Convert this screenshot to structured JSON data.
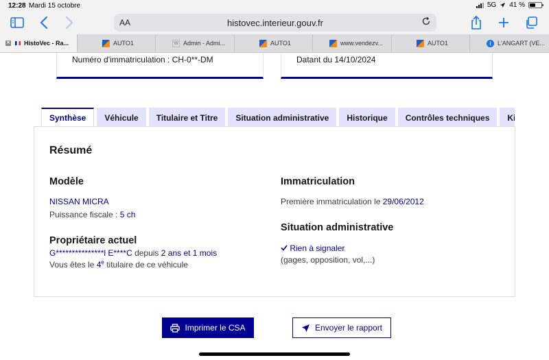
{
  "statusbar": {
    "time": "12:28",
    "date": "Mardi 15 octobre",
    "network": "5G",
    "battery": "41 %"
  },
  "browser": {
    "address_aa": "AA",
    "url": "histovec.interieur.gouv.fr",
    "tabs": [
      {
        "label": "HistoVec - Ra...",
        "active": true,
        "favicon": "french-flag-icon"
      },
      {
        "label": "AUTO1",
        "favicon": "auto1-icon"
      },
      {
        "label": "Admin - Admi...",
        "favicon": "w-icon"
      },
      {
        "label": "AUTO1",
        "favicon": "auto1-icon"
      },
      {
        "label": "www.vendezv...",
        "favicon": "auto1-icon"
      },
      {
        "label": "AUTO1",
        "favicon": "auto1-icon"
      },
      {
        "label": "L'ANGART (VE...",
        "favicon": "info-icon"
      }
    ]
  },
  "topcards": {
    "left": "Numéro d'immatriculation : CH-0**-DM",
    "right": "Datant du 14/10/2024"
  },
  "content_tabs": [
    "Synthèse",
    "Véhicule",
    "Titulaire et Titre",
    "Situation administrative",
    "Historique",
    "Contrôles techniques",
    "Kilo"
  ],
  "summary": {
    "title": "Résumé",
    "modele": {
      "heading": "Modèle",
      "name": "NISSAN MICRA",
      "power_label": "Puissance fiscale : ",
      "power_value": "5 ch"
    },
    "proprietaire": {
      "heading": "Propriétaire actuel",
      "name": "G***************l E****C",
      "since_label": " depuis ",
      "since_value": "2 ans et 1 mois",
      "titulaire_prefix": "Vous êtes le ",
      "titulaire_num": "4",
      "titulaire_sup": "e",
      "titulaire_suffix": " titulaire de ce véhicule"
    },
    "immatriculation": {
      "heading": "Immatriculation",
      "label": "Première immatriculation le ",
      "date": "29/06/2012"
    },
    "situation": {
      "heading": "Situation administrative",
      "status": "Rien à signaler",
      "detail": "(gages, opposition, vol,...)"
    }
  },
  "actions": {
    "print": "Imprimer le CSA",
    "send": "Envoyer le rapport"
  },
  "colors": {
    "primary": "#000091",
    "tab_bg": "#e3e3fd"
  }
}
